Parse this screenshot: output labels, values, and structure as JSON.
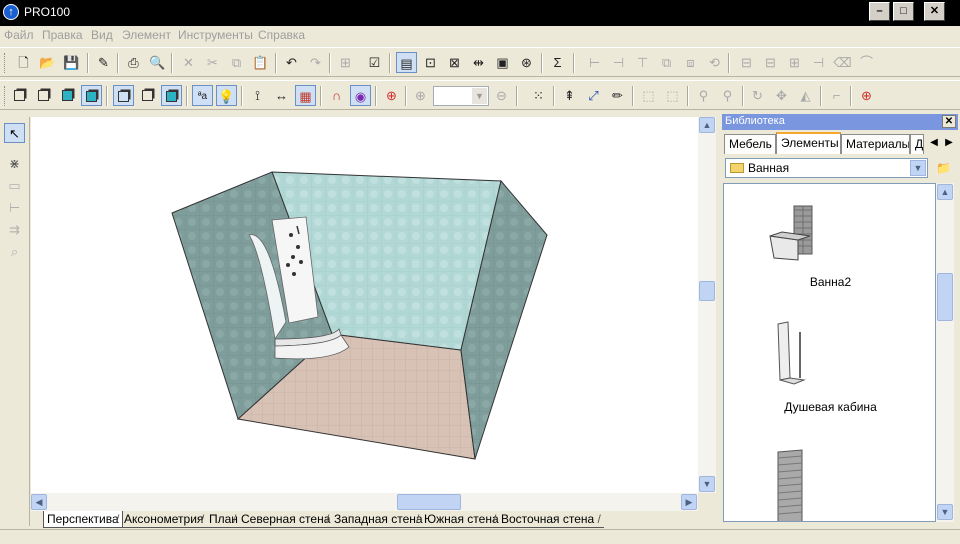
{
  "window": {
    "title": "PRO100",
    "app_icon": "arrow-up-icon",
    "controls": [
      "minimize-icon",
      "maximize-icon",
      "close-icon"
    ]
  },
  "menu": {
    "items": [
      "Файл",
      "Правка",
      "Вид",
      "Элемент",
      "Инструменты",
      "Справка"
    ]
  },
  "toolbar1": {
    "icons": [
      "new-file-icon",
      "open-folder-icon",
      "save-icon",
      "edit-properties-icon",
      "print-icon",
      "print-preview-icon",
      "delete-icon",
      "cut-icon",
      "copy-icon",
      "paste-icon",
      "undo-icon",
      "redo-icon",
      "group-icon",
      "checklist-icon",
      "view-mode-icon",
      "zoom-window-icon",
      "zoom-object-icon",
      "fit-width-icon",
      "render-icon",
      "price-icon",
      "sum-icon",
      "align-left-icon",
      "align-center-icon",
      "align-top-icon",
      "duplicate-icon",
      "mirror-icon",
      "distribute-h-icon",
      "distribute-v-icon",
      "distribute-depth-icon",
      "rotate-icon",
      "eraser-icon"
    ]
  },
  "toolbar2": {
    "icons": [
      "wireframe-cube-icon",
      "hidden-lines-cube-icon",
      "shaded-cube-icon",
      "textured-cube-icon",
      "front-cube-icon",
      "side-cube-icon",
      "solid-cube-icon",
      "text-size-icon",
      "lightbulb-icon",
      "measure-icon",
      "dimension-icon",
      "grid-icon",
      "magnet-icon",
      "target-icon",
      "crosshair-icon",
      "zoom-in-icon",
      "zoom-out-icon",
      "select-all-icon",
      "move-up-icon",
      "move-icon",
      "pencil-icon",
      "bounding-box-icon",
      "snap-box-icon",
      "pin-icon",
      "pin-alt-icon",
      "rotate-icon",
      "move-arrows-icon",
      "mirror-axis-icon",
      "corner-icon",
      "crosshair-red-icon"
    ],
    "zoom_value": ""
  },
  "left_toolbar": {
    "icons": [
      "pointer-icon",
      "explode-icon",
      "select-frame-icon",
      "align-icon",
      "distribute-icon",
      "zoom-icon"
    ]
  },
  "view_tabs": [
    "Перспектива",
    "Аксонометрия",
    "План",
    "Северная стена",
    "Западная стена",
    "Южная стена",
    "Восточная стена"
  ],
  "active_view_tab": 0,
  "library": {
    "title": "Библиотека",
    "tabs": [
      "Мебель",
      "Элементы",
      "Материалы",
      "Д"
    ],
    "active_tab": 1,
    "folder": "Ванная",
    "items": [
      "Ванна2",
      "Душевая кабина",
      ""
    ]
  },
  "colors": {
    "wall_color": "#b2d8d6",
    "wall_dark": "#7f9d9b",
    "floor_color": "#d8c2b6",
    "active_tab_accent": "#f4a92e",
    "library_title_bg": "#7a96df"
  }
}
